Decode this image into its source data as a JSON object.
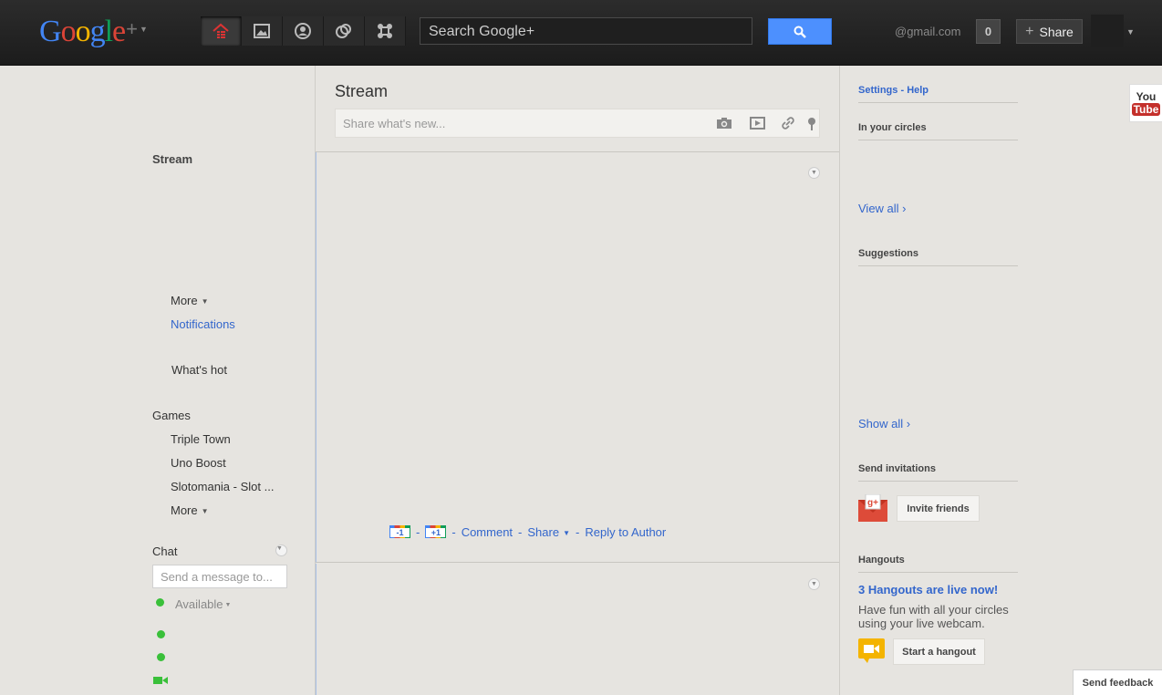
{
  "header": {
    "logo": {
      "g1": "G",
      "o1": "o",
      "o2": "o",
      "g2": "g",
      "l": "l",
      "e": "e",
      "plus": "+"
    },
    "nav": [
      "home-icon",
      "photos-icon",
      "profile-icon",
      "circles-icon",
      "games-icon"
    ],
    "search_placeholder": "Search Google+",
    "email": "@gmail.com",
    "notification_count": "0",
    "share_label": "Share"
  },
  "stream": {
    "title": "Stream",
    "share_placeholder": "Share what's new...",
    "actions": {
      "minus_one": "-1",
      "plus_one": "+1",
      "dash": "-",
      "comment": "Comment",
      "share": "Share",
      "reply": "Reply to Author"
    }
  },
  "left_nav": {
    "stream": "Stream",
    "more": "More",
    "notifications": "Notifications",
    "whats_hot": "What's hot",
    "games_heading": "Games",
    "games": [
      "Triple Town",
      "Uno Boost",
      "Slotomania - Slot ..."
    ],
    "games_more": "More",
    "chat_title": "Chat",
    "chat_placeholder": "Send a message to...",
    "status": "Available"
  },
  "right_col": {
    "settings": "Settings",
    "settings_sep": " - ",
    "help": "Help",
    "in_circles": "In your circles",
    "view_all": "View all ›",
    "suggestions": "Suggestions",
    "show_all": "Show all ›",
    "send_invitations": "Send invitations",
    "invite_friends": "Invite friends",
    "hangouts": "Hangouts",
    "hangouts_live": "3 Hangouts are live now!",
    "hangouts_desc": "Have fun with all your circles using your live webcam.",
    "start_hangout": "Start a hangout"
  },
  "youtube": {
    "you": "You",
    "tube": "Tube"
  },
  "feedback": "Send feedback",
  "colors": {
    "accent": "#3366cc",
    "search_button": "#4d90fe",
    "status_green": "#3ac03a"
  }
}
